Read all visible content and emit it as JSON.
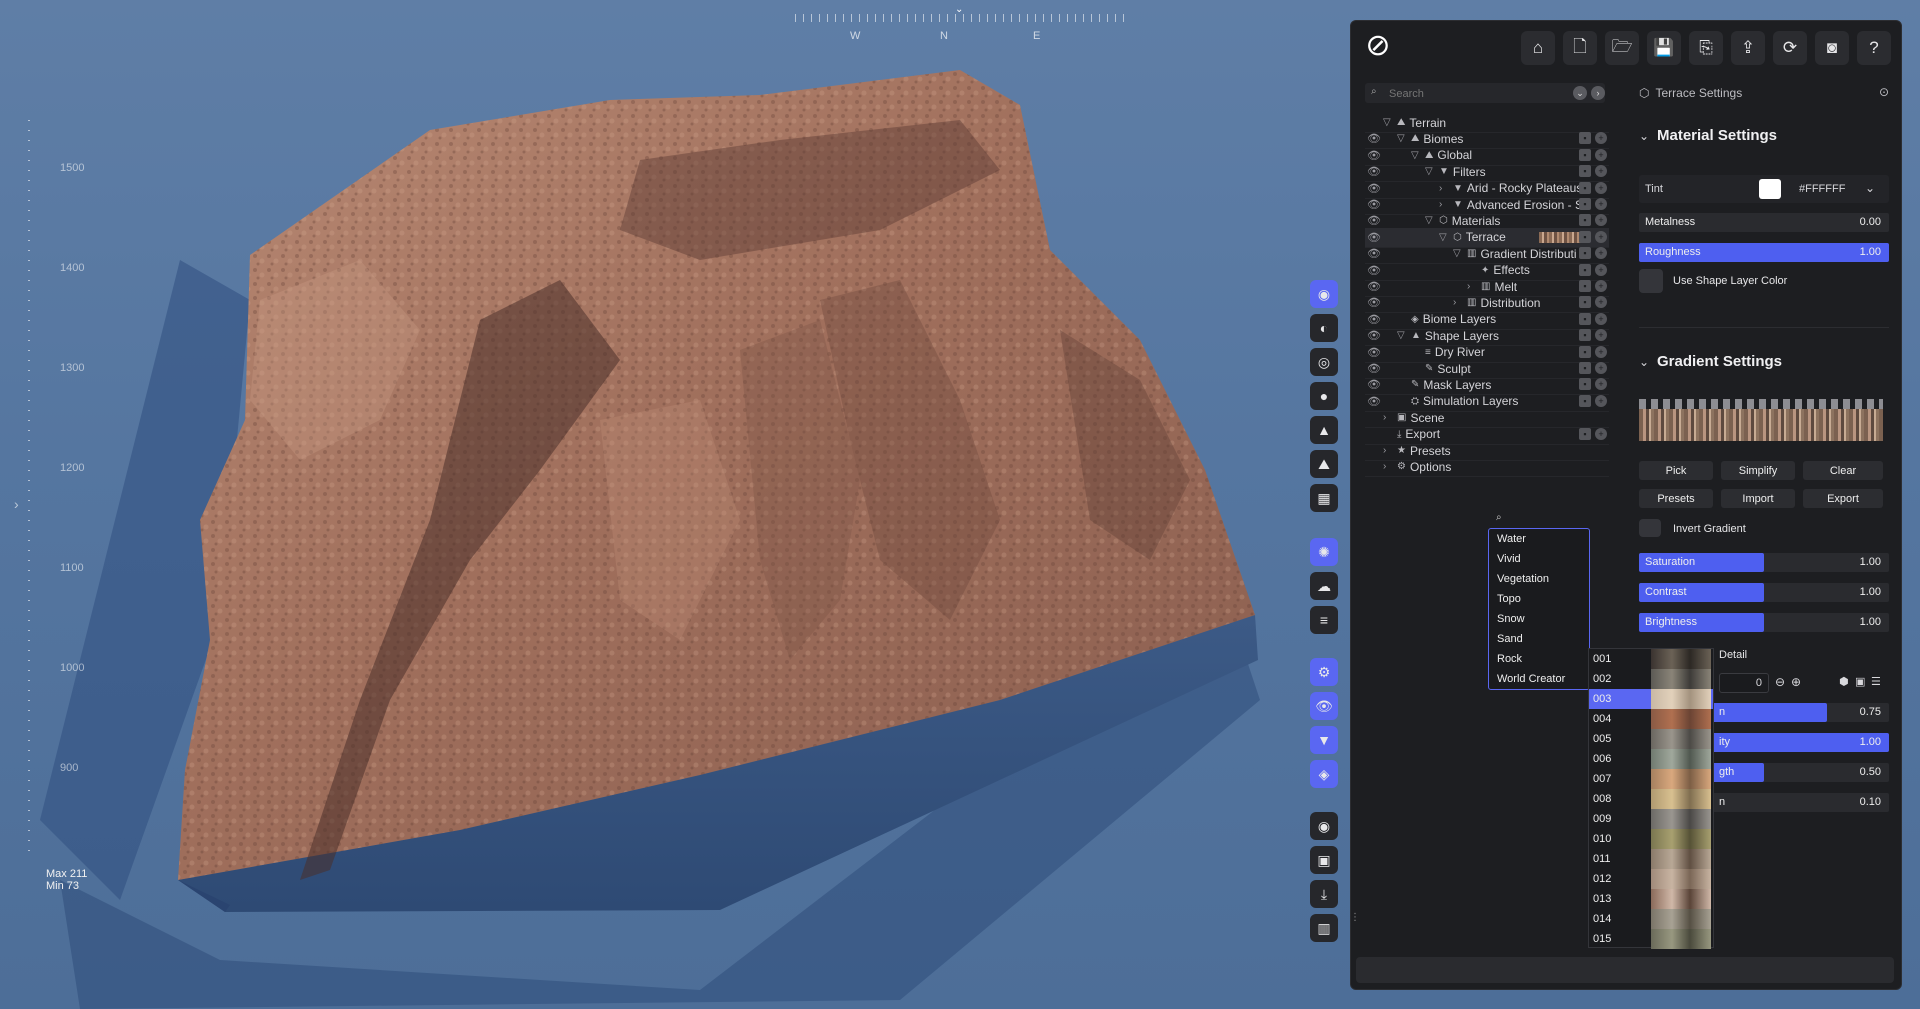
{
  "viewport": {
    "compass": [
      "W",
      "N",
      "E"
    ],
    "ruler_labels": [
      "1500",
      "1400",
      "1300",
      "1200",
      "1100",
      "1000",
      "900"
    ],
    "hud_max": "Max 211",
    "hud_min": "Min 73"
  },
  "toolbar": {
    "icons": [
      "home-icon",
      "new-file-icon",
      "open-folder-icon",
      "save-icon",
      "save-as-icon",
      "export-icon",
      "sync-icon",
      "camera-icon",
      "help-icon"
    ]
  },
  "tool_strip": {
    "icons": [
      "terrain-tool",
      "erosion-tool",
      "sediment-tool",
      "water-drop-tool",
      "mountain-tool",
      "landscape-tool",
      "grid-tool",
      "sun-tool",
      "weather-tool",
      "layers-lines-tool",
      "settings-gear-tool",
      "eye-tool",
      "filter-tool",
      "stack-tool",
      "record-tool",
      "image-tool",
      "download-tool",
      "chart-tool"
    ],
    "active_indices": [
      0,
      7,
      10,
      11,
      12,
      13
    ]
  },
  "tree": {
    "search_placeholder": "Search",
    "rows": [
      {
        "label": "Terrain",
        "depth": 0,
        "eye": false,
        "caret": "▽"
      },
      {
        "label": "Biomes",
        "depth": 1,
        "eye": true,
        "caret": "▽"
      },
      {
        "label": "Global",
        "depth": 2,
        "eye": true,
        "caret": "▽"
      },
      {
        "label": "Filters",
        "depth": 3,
        "eye": true,
        "caret": "▽"
      },
      {
        "label": "Arid - Rocky Plateaus",
        "depth": 4,
        "eye": true,
        "caret": "›"
      },
      {
        "label": "Advanced Erosion - Se",
        "depth": 4,
        "eye": true,
        "caret": "›"
      },
      {
        "label": "Materials",
        "depth": 3,
        "eye": true,
        "caret": "▽"
      },
      {
        "label": "Terrace",
        "depth": 4,
        "eye": true,
        "caret": "▽",
        "selected": true
      },
      {
        "label": "Gradient Distributi",
        "depth": 5,
        "eye": true,
        "caret": "▽"
      },
      {
        "label": "Effects",
        "depth": 6,
        "eye": true,
        "caret": ""
      },
      {
        "label": "Melt",
        "depth": 6,
        "eye": true,
        "caret": "›"
      },
      {
        "label": "Distribution",
        "depth": 5,
        "eye": true,
        "caret": "›"
      },
      {
        "label": "Biome Layers",
        "depth": 1,
        "eye": true,
        "caret": ""
      },
      {
        "label": "Shape Layers",
        "depth": 1,
        "eye": true,
        "caret": "▽"
      },
      {
        "label": "Dry River",
        "depth": 2,
        "eye": true,
        "caret": ""
      },
      {
        "label": "Sculpt",
        "depth": 2,
        "eye": true,
        "caret": ""
      },
      {
        "label": "Mask Layers",
        "depth": 1,
        "eye": true,
        "caret": ""
      },
      {
        "label": "Simulation Layers",
        "depth": 1,
        "eye": true,
        "caret": ""
      },
      {
        "label": "Scene",
        "depth": 0,
        "eye": false,
        "caret": "›"
      },
      {
        "label": "Export",
        "depth": 0,
        "eye": false,
        "caret": ""
      },
      {
        "label": "Presets",
        "depth": 0,
        "eye": false,
        "caret": "›"
      },
      {
        "label": "Options",
        "depth": 0,
        "eye": false,
        "caret": "›"
      }
    ]
  },
  "settings": {
    "header": "Terrace Settings",
    "material_title": "Material Settings",
    "tint_label": "Tint",
    "tint_value": "#FFFFFF",
    "metalness": {
      "label": "Metalness",
      "value": "0.00",
      "fraction": 0.0
    },
    "roughness": {
      "label": "Roughness",
      "value": "1.00",
      "fraction": 1.0
    },
    "use_shape_color": "Use Shape Layer Color",
    "gradient_title": "Gradient Settings",
    "buttons_row1": [
      "Pick",
      "Simplify",
      "Clear"
    ],
    "buttons_row2": [
      "Presets",
      "Import",
      "Export"
    ],
    "invert_gradient": "Invert Gradient",
    "saturation": {
      "label": "Saturation",
      "value": "1.00",
      "fraction": 0.5
    },
    "contrast": {
      "label": "Contrast",
      "value": "1.00",
      "fraction": 0.5
    },
    "brightness": {
      "label": "Brightness",
      "value": "1.00",
      "fraction": 0.5
    },
    "detail_label": "Detail",
    "detail_input": "0",
    "hidden_sliders": [
      {
        "label": "n",
        "value": "0.75",
        "fraction": 0.75
      },
      {
        "label": "ity",
        "value": "1.00",
        "fraction": 1.0
      },
      {
        "label": "gth",
        "value": "0.50",
        "fraction": 0.5
      },
      {
        "label": "n",
        "value": "0.10",
        "fraction": 0.0
      }
    ]
  },
  "preset_popup": {
    "items": [
      "Water",
      "Vivid",
      "Vegetation",
      "Topo",
      "Snow",
      "Sand",
      "Rock",
      "World Creator"
    ]
  },
  "swatch_list": {
    "items": [
      "001",
      "002",
      "003",
      "004",
      "005",
      "006",
      "007",
      "008",
      "009",
      "010",
      "011",
      "012",
      "013",
      "014",
      "015"
    ],
    "selected": "003"
  }
}
